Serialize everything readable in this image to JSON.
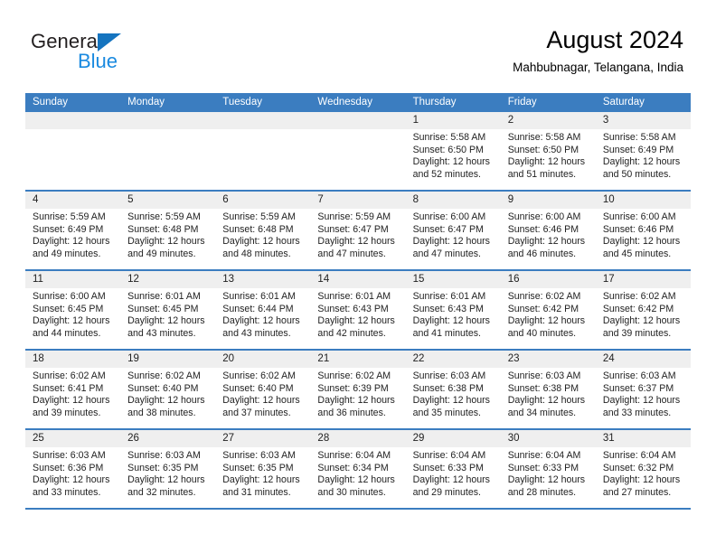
{
  "brand": {
    "name_part1": "General",
    "name_part2": "Blue",
    "triangle_color": "#1574bf",
    "blue_color": "#1a8ae0"
  },
  "header": {
    "title": "August 2024",
    "subtitle": "Mahbubnagar, Telangana, India"
  },
  "theme": {
    "header_blue": "#3b7dc0",
    "day_band_gray": "#efefef",
    "text": "#222222"
  },
  "calendar": {
    "day_headers": [
      "Sunday",
      "Monday",
      "Tuesday",
      "Wednesday",
      "Thursday",
      "Friday",
      "Saturday"
    ],
    "weeks": [
      [
        {
          "day": "",
          "sunrise": "",
          "sunset": "",
          "daylight1": "",
          "daylight2": ""
        },
        {
          "day": "",
          "sunrise": "",
          "sunset": "",
          "daylight1": "",
          "daylight2": ""
        },
        {
          "day": "",
          "sunrise": "",
          "sunset": "",
          "daylight1": "",
          "daylight2": ""
        },
        {
          "day": "",
          "sunrise": "",
          "sunset": "",
          "daylight1": "",
          "daylight2": ""
        },
        {
          "day": "1",
          "sunrise": "Sunrise: 5:58 AM",
          "sunset": "Sunset: 6:50 PM",
          "daylight1": "Daylight: 12 hours",
          "daylight2": "and 52 minutes."
        },
        {
          "day": "2",
          "sunrise": "Sunrise: 5:58 AM",
          "sunset": "Sunset: 6:50 PM",
          "daylight1": "Daylight: 12 hours",
          "daylight2": "and 51 minutes."
        },
        {
          "day": "3",
          "sunrise": "Sunrise: 5:58 AM",
          "sunset": "Sunset: 6:49 PM",
          "daylight1": "Daylight: 12 hours",
          "daylight2": "and 50 minutes."
        }
      ],
      [
        {
          "day": "4",
          "sunrise": "Sunrise: 5:59 AM",
          "sunset": "Sunset: 6:49 PM",
          "daylight1": "Daylight: 12 hours",
          "daylight2": "and 49 minutes."
        },
        {
          "day": "5",
          "sunrise": "Sunrise: 5:59 AM",
          "sunset": "Sunset: 6:48 PM",
          "daylight1": "Daylight: 12 hours",
          "daylight2": "and 49 minutes."
        },
        {
          "day": "6",
          "sunrise": "Sunrise: 5:59 AM",
          "sunset": "Sunset: 6:48 PM",
          "daylight1": "Daylight: 12 hours",
          "daylight2": "and 48 minutes."
        },
        {
          "day": "7",
          "sunrise": "Sunrise: 5:59 AM",
          "sunset": "Sunset: 6:47 PM",
          "daylight1": "Daylight: 12 hours",
          "daylight2": "and 47 minutes."
        },
        {
          "day": "8",
          "sunrise": "Sunrise: 6:00 AM",
          "sunset": "Sunset: 6:47 PM",
          "daylight1": "Daylight: 12 hours",
          "daylight2": "and 47 minutes."
        },
        {
          "day": "9",
          "sunrise": "Sunrise: 6:00 AM",
          "sunset": "Sunset: 6:46 PM",
          "daylight1": "Daylight: 12 hours",
          "daylight2": "and 46 minutes."
        },
        {
          "day": "10",
          "sunrise": "Sunrise: 6:00 AM",
          "sunset": "Sunset: 6:46 PM",
          "daylight1": "Daylight: 12 hours",
          "daylight2": "and 45 minutes."
        }
      ],
      [
        {
          "day": "11",
          "sunrise": "Sunrise: 6:00 AM",
          "sunset": "Sunset: 6:45 PM",
          "daylight1": "Daylight: 12 hours",
          "daylight2": "and 44 minutes."
        },
        {
          "day": "12",
          "sunrise": "Sunrise: 6:01 AM",
          "sunset": "Sunset: 6:45 PM",
          "daylight1": "Daylight: 12 hours",
          "daylight2": "and 43 minutes."
        },
        {
          "day": "13",
          "sunrise": "Sunrise: 6:01 AM",
          "sunset": "Sunset: 6:44 PM",
          "daylight1": "Daylight: 12 hours",
          "daylight2": "and 43 minutes."
        },
        {
          "day": "14",
          "sunrise": "Sunrise: 6:01 AM",
          "sunset": "Sunset: 6:43 PM",
          "daylight1": "Daylight: 12 hours",
          "daylight2": "and 42 minutes."
        },
        {
          "day": "15",
          "sunrise": "Sunrise: 6:01 AM",
          "sunset": "Sunset: 6:43 PM",
          "daylight1": "Daylight: 12 hours",
          "daylight2": "and 41 minutes."
        },
        {
          "day": "16",
          "sunrise": "Sunrise: 6:02 AM",
          "sunset": "Sunset: 6:42 PM",
          "daylight1": "Daylight: 12 hours",
          "daylight2": "and 40 minutes."
        },
        {
          "day": "17",
          "sunrise": "Sunrise: 6:02 AM",
          "sunset": "Sunset: 6:42 PM",
          "daylight1": "Daylight: 12 hours",
          "daylight2": "and 39 minutes."
        }
      ],
      [
        {
          "day": "18",
          "sunrise": "Sunrise: 6:02 AM",
          "sunset": "Sunset: 6:41 PM",
          "daylight1": "Daylight: 12 hours",
          "daylight2": "and 39 minutes."
        },
        {
          "day": "19",
          "sunrise": "Sunrise: 6:02 AM",
          "sunset": "Sunset: 6:40 PM",
          "daylight1": "Daylight: 12 hours",
          "daylight2": "and 38 minutes."
        },
        {
          "day": "20",
          "sunrise": "Sunrise: 6:02 AM",
          "sunset": "Sunset: 6:40 PM",
          "daylight1": "Daylight: 12 hours",
          "daylight2": "and 37 minutes."
        },
        {
          "day": "21",
          "sunrise": "Sunrise: 6:02 AM",
          "sunset": "Sunset: 6:39 PM",
          "daylight1": "Daylight: 12 hours",
          "daylight2": "and 36 minutes."
        },
        {
          "day": "22",
          "sunrise": "Sunrise: 6:03 AM",
          "sunset": "Sunset: 6:38 PM",
          "daylight1": "Daylight: 12 hours",
          "daylight2": "and 35 minutes."
        },
        {
          "day": "23",
          "sunrise": "Sunrise: 6:03 AM",
          "sunset": "Sunset: 6:38 PM",
          "daylight1": "Daylight: 12 hours",
          "daylight2": "and 34 minutes."
        },
        {
          "day": "24",
          "sunrise": "Sunrise: 6:03 AM",
          "sunset": "Sunset: 6:37 PM",
          "daylight1": "Daylight: 12 hours",
          "daylight2": "and 33 minutes."
        }
      ],
      [
        {
          "day": "25",
          "sunrise": "Sunrise: 6:03 AM",
          "sunset": "Sunset: 6:36 PM",
          "daylight1": "Daylight: 12 hours",
          "daylight2": "and 33 minutes."
        },
        {
          "day": "26",
          "sunrise": "Sunrise: 6:03 AM",
          "sunset": "Sunset: 6:35 PM",
          "daylight1": "Daylight: 12 hours",
          "daylight2": "and 32 minutes."
        },
        {
          "day": "27",
          "sunrise": "Sunrise: 6:03 AM",
          "sunset": "Sunset: 6:35 PM",
          "daylight1": "Daylight: 12 hours",
          "daylight2": "and 31 minutes."
        },
        {
          "day": "28",
          "sunrise": "Sunrise: 6:04 AM",
          "sunset": "Sunset: 6:34 PM",
          "daylight1": "Daylight: 12 hours",
          "daylight2": "and 30 minutes."
        },
        {
          "day": "29",
          "sunrise": "Sunrise: 6:04 AM",
          "sunset": "Sunset: 6:33 PM",
          "daylight1": "Daylight: 12 hours",
          "daylight2": "and 29 minutes."
        },
        {
          "day": "30",
          "sunrise": "Sunrise: 6:04 AM",
          "sunset": "Sunset: 6:33 PM",
          "daylight1": "Daylight: 12 hours",
          "daylight2": "and 28 minutes."
        },
        {
          "day": "31",
          "sunrise": "Sunrise: 6:04 AM",
          "sunset": "Sunset: 6:32 PM",
          "daylight1": "Daylight: 12 hours",
          "daylight2": "and 27 minutes."
        }
      ]
    ]
  }
}
